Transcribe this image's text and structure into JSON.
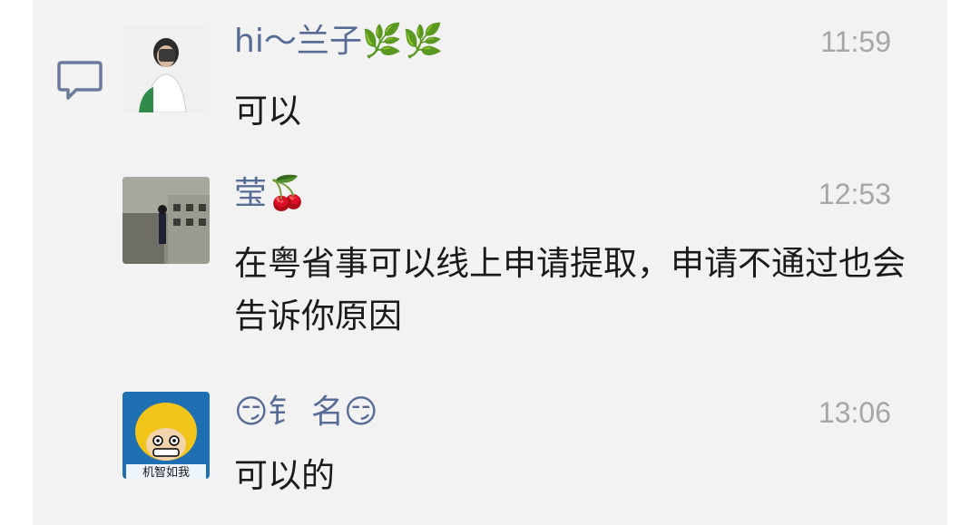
{
  "comments": [
    {
      "author": "hi～兰子🌿🌿",
      "time": "11:59",
      "text": "可以"
    },
    {
      "author": "莹🍒",
      "time": "12:53",
      "text": "在粤省事可以线上申请提取，申请不通过也会告诉你原因"
    },
    {
      "author_prefix": "😏钅 名😏",
      "time": "13:06",
      "text": "可以的",
      "avatar_caption": "机智如我"
    }
  ],
  "icons": {
    "comment": "comment-icon",
    "leaf": "leaf-emoji-icon",
    "cherry": "cherry-emoji-icon",
    "smirk": "smirk-emoji-icon"
  },
  "colors": {
    "name": "#576b95",
    "time": "#a6a6a6",
    "text": "#1a1a1a",
    "panel": "#f2f2f2"
  }
}
